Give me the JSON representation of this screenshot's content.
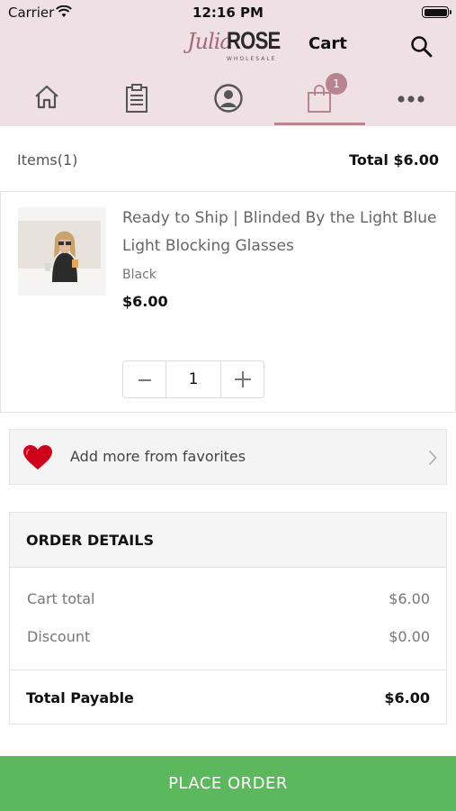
{
  "status_bar": {
    "carrier": "Carrier",
    "time": "12:16 PM"
  },
  "header": {
    "logo": {
      "script": "Julia",
      "bold": "ROSE",
      "sub": "WHOLESALE"
    },
    "title": "Cart",
    "cart_badge": "1",
    "tabs": [
      "home-icon",
      "clipboard-icon",
      "account-icon",
      "shopping-bag-icon",
      "more-icon"
    ],
    "active_tab": "shopping-bag-icon"
  },
  "cart": {
    "items_label": "Items(1)",
    "total_label": "Total  $6.00"
  },
  "product": {
    "title": "Ready to Ship | Blinded By the Light Blue Light Blocking Glasses",
    "variant": "Black",
    "price": "$6.00",
    "quantity": "1"
  },
  "favorites": {
    "label": "Add more from favorites"
  },
  "order_details": {
    "title": "ORDER DETAILS",
    "rows": [
      {
        "label": "Cart total",
        "value": "$6.00"
      },
      {
        "label": "Discount",
        "value": "$0.00"
      }
    ],
    "payable_label": "Total Payable",
    "payable_value": "$6.00"
  },
  "place_order": {
    "label": "PLACE ORDER"
  },
  "colors": {
    "header_bg": "#efe0e6",
    "accent": "#b8848f",
    "cta": "#5cb85c",
    "heart": "#d0021b"
  }
}
